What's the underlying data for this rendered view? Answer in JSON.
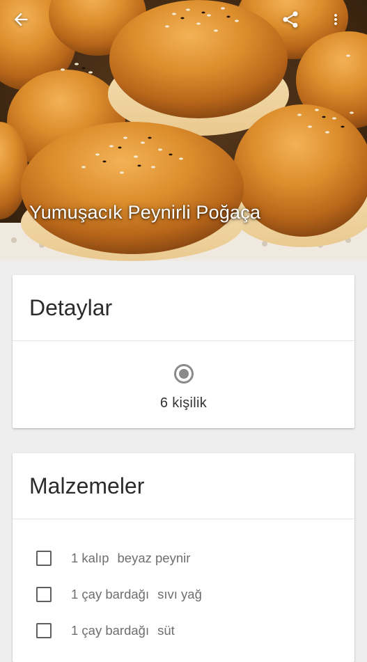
{
  "app_bar": {
    "back_icon": "arrow-back-icon",
    "share_icon": "share-icon",
    "more_icon": "more-vert-icon"
  },
  "recipe": {
    "title": "Yumuşacık Peynirli Poğaça",
    "hero_image": "sesame-topped-pastry-buns-photo"
  },
  "details": {
    "heading": "Detaylar",
    "servings_icon": "radio-circle-icon",
    "servings": "6 kişilik"
  },
  "ingredients": {
    "heading": "Malzemeler",
    "items": [
      {
        "qty": "1 kalıp",
        "name": "beyaz peynir",
        "checked": false
      },
      {
        "qty": "1 çay bardağı",
        "name": "sıvı yağ",
        "checked": false
      },
      {
        "qty": "1 çay bardağı",
        "name": "süt",
        "checked": false
      }
    ]
  },
  "colors": {
    "background": "#eeeeee",
    "card": "#ffffff",
    "icon_gray": "#8a8a8a"
  }
}
